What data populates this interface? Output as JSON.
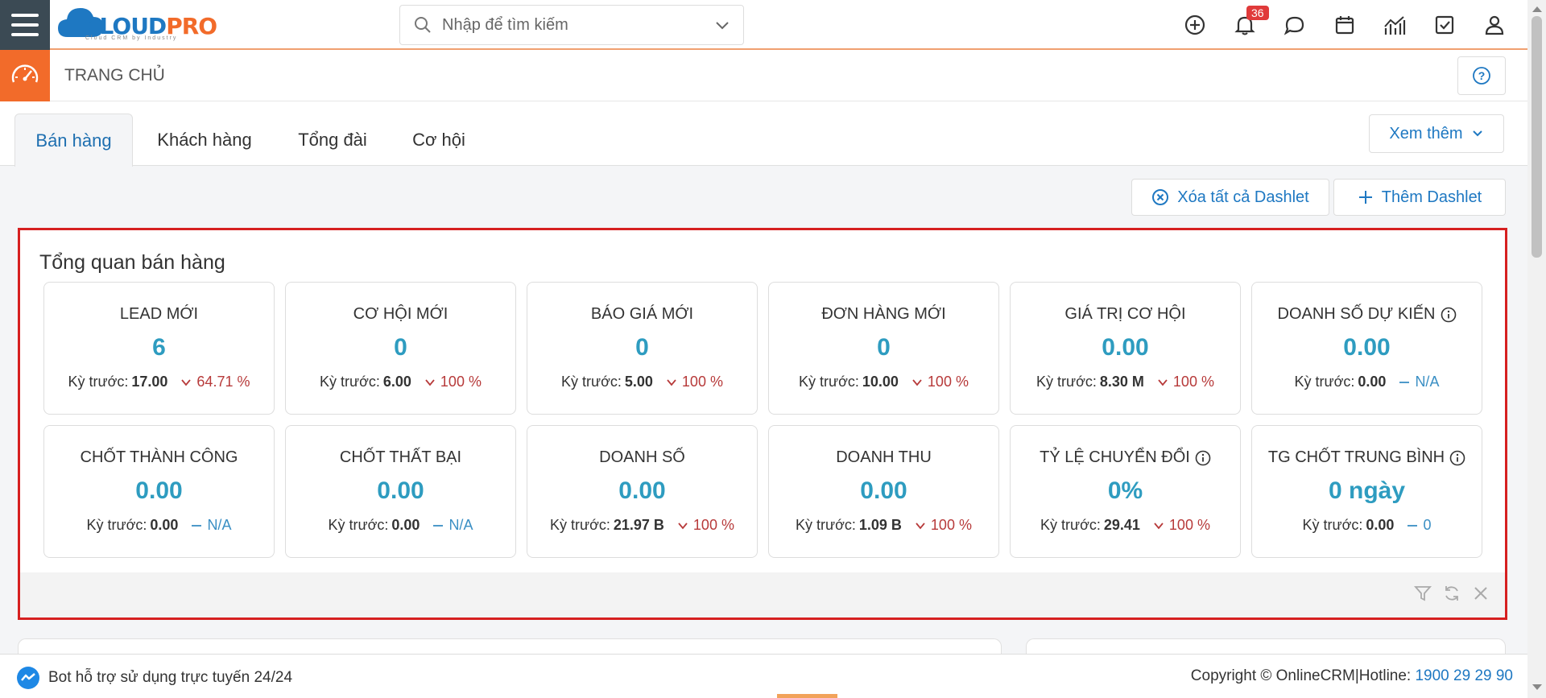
{
  "brand": {
    "name_part1": "CLOUD",
    "name_part2": "PRO",
    "tagline": "Cloud CRM by Industry"
  },
  "search": {
    "placeholder": "Nhập để tìm kiếm"
  },
  "header": {
    "notification_count": "36"
  },
  "page": {
    "title": "TRANG CHỦ"
  },
  "tabs": [
    {
      "label": "Bán hàng"
    },
    {
      "label": "Khách hàng"
    },
    {
      "label": "Tổng đài"
    },
    {
      "label": "Cơ hội"
    }
  ],
  "more_label": "Xem thêm",
  "actions": {
    "clear_label": "Xóa tất cả Dashlet",
    "add_label": "Thêm Dashlet"
  },
  "dashlet": {
    "title": "Tổng quan bán hàng",
    "prev_label": "Kỳ trước:",
    "cards": [
      {
        "label": "LEAD MỚI",
        "value": "6",
        "prev": "17.00",
        "change": "64.71 %"
      },
      {
        "label": "CƠ HỘI MỚI",
        "value": "0",
        "prev": "6.00",
        "change": "100 %"
      },
      {
        "label": "BÁO GIÁ MỚI",
        "value": "0",
        "prev": "5.00",
        "change": "100 %"
      },
      {
        "label": "ĐƠN HÀNG MỚI",
        "value": "0",
        "prev": "10.00",
        "change": "100 %"
      },
      {
        "label": "GIÁ TRỊ CƠ HỘI",
        "value": "0.00",
        "prev": "8.30 M",
        "change": "100 %"
      },
      {
        "label": "DOANH SỐ DỰ KIẾN",
        "value": "0.00",
        "prev": "0.00",
        "change": "N/A"
      },
      {
        "label": "CHỐT THÀNH CÔNG",
        "value": "0.00",
        "prev": "0.00",
        "change": "N/A"
      },
      {
        "label": "CHỐT THẤT BẠI",
        "value": "0.00",
        "prev": "0.00",
        "change": "N/A"
      },
      {
        "label": "DOANH SỐ",
        "value": "0.00",
        "prev": "21.97 B",
        "change": "100 %"
      },
      {
        "label": "DOANH THU",
        "value": "0.00",
        "prev": "1.09 B",
        "change": "100 %"
      },
      {
        "label": "TỶ LỆ CHUYỂN ĐỔI",
        "value": "0%",
        "prev": "29.41",
        "change": "100 %"
      },
      {
        "label": "TG CHỐT TRUNG BÌNH",
        "value": "0 ngày",
        "prev": "0.00",
        "change": "0"
      }
    ]
  },
  "footer": {
    "bot_text": "Bot hỗ trợ sử dụng trực tuyến 24/24",
    "copyright": "Copyright © OnlineCRM|Hotline:",
    "hotline": "1900 29 29 90"
  },
  "colors": {
    "accent": "#f26b2a",
    "primary": "#1e78c2",
    "value": "#2e9cc0",
    "down": "#b73a3a",
    "highlight": "#d62020"
  }
}
